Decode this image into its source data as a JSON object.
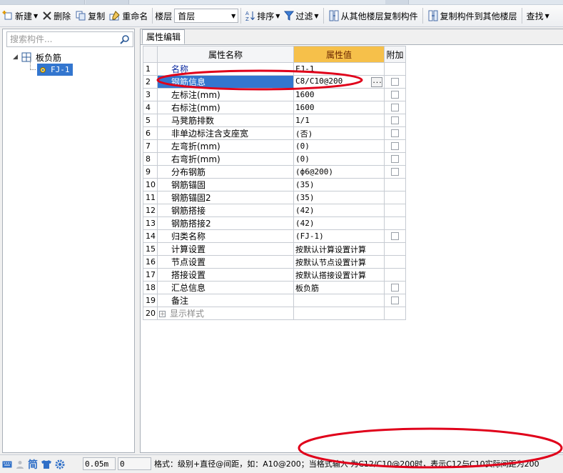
{
  "toolbar": {
    "new_label": "新建",
    "delete_label": "删除",
    "copy_label": "复制",
    "rename_label": "重命名",
    "floor_label": "楼层",
    "floor_value": "首层",
    "sort_label": "排序",
    "filter_label": "过滤",
    "copy_from_other_floors_label": "从其他楼层复制构件",
    "copy_to_other_floors_label": "复制构件到其他楼层",
    "find_label": "查找"
  },
  "left_panel": {
    "search_placeholder": "搜索构件...",
    "tree": {
      "root_label": "板负筋",
      "child_label": "FJ-1"
    }
  },
  "right_panel": {
    "tab_label": "属性编辑",
    "columns": {
      "name": "属性名称",
      "value": "属性值",
      "extra": "附加"
    },
    "rows": [
      {
        "num": "1",
        "name": "名称",
        "value": "FJ-1"
      },
      {
        "num": "2",
        "name": "钢筋信息",
        "value": "C8/C10@200"
      },
      {
        "num": "3",
        "name": "左标注(mm)",
        "value": "1600"
      },
      {
        "num": "4",
        "name": "右标注(mm)",
        "value": "1600"
      },
      {
        "num": "5",
        "name": "马凳筋排数",
        "value": "1/1"
      },
      {
        "num": "6",
        "name": "非单边标注含支座宽",
        "value": "(否)"
      },
      {
        "num": "7",
        "name": "左弯折(mm)",
        "value": "(0)"
      },
      {
        "num": "8",
        "name": "右弯折(mm)",
        "value": "(0)"
      },
      {
        "num": "9",
        "name": "分布钢筋",
        "value": "(ф6@200)"
      },
      {
        "num": "10",
        "name": "钢筋锚固",
        "value": "(35)"
      },
      {
        "num": "11",
        "name": "钢筋锚固2",
        "value": "(35)"
      },
      {
        "num": "12",
        "name": "钢筋搭接",
        "value": "(42)"
      },
      {
        "num": "13",
        "name": "钢筋搭接2",
        "value": "(42)"
      },
      {
        "num": "14",
        "name": "归类名称",
        "value": "(FJ-1)"
      },
      {
        "num": "15",
        "name": "计算设置",
        "value": "按默认计算设置计算"
      },
      {
        "num": "16",
        "name": "节点设置",
        "value": "按默认节点设置计算"
      },
      {
        "num": "17",
        "name": "搭接设置",
        "value": "按默认搭接设置计算"
      },
      {
        "num": "18",
        "name": "汇总信息",
        "value": "板负筋"
      },
      {
        "num": "19",
        "name": "备注",
        "value": ""
      },
      {
        "num": "20",
        "name": "显示样式",
        "value": ""
      }
    ],
    "edit_button_label": "..."
  },
  "statusbar": {
    "ime_label": "简",
    "elevation": "0.05m",
    "count": "0",
    "message": "格式：级别+直径@间距，如：A10@200；当格式输入 为C12/C10@200时，表示C12与C10实际间距为200"
  },
  "colors": {
    "selection": "#3376cf",
    "value_header": "#f6c04a",
    "annotation": "#e0001a"
  }
}
